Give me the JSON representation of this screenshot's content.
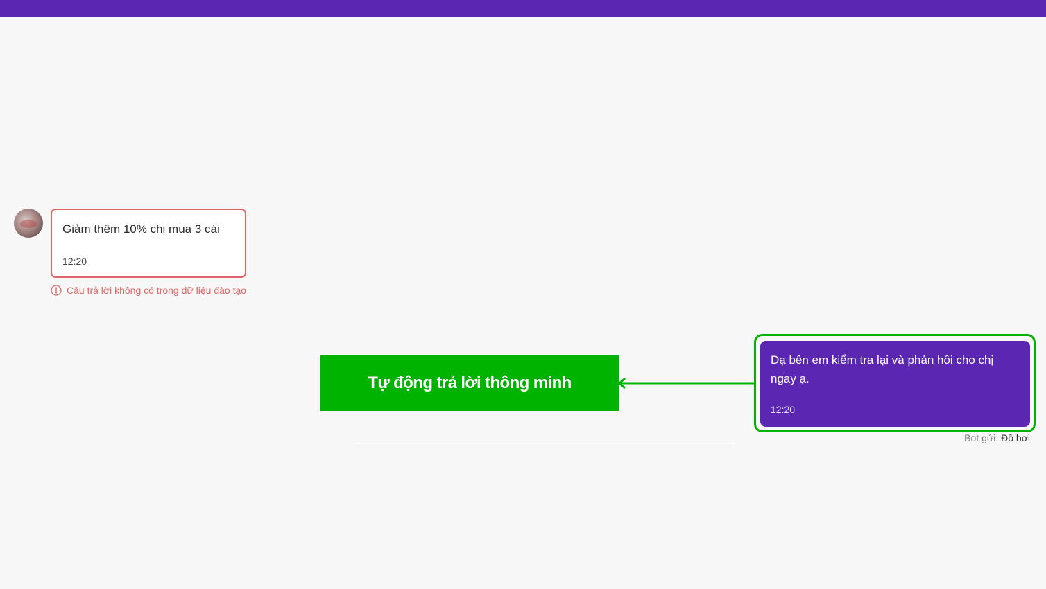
{
  "colors": {
    "top_bar": "#5b27b2",
    "incoming_border": "#e06666",
    "warning_text": "#e06666",
    "feature_label_bg": "#00b300",
    "highlight_frame": "#00b300",
    "outgoing_bubble_bg": "#5b27b2"
  },
  "incoming": {
    "message": "Giảm thêm 10% chị mua 3 cái",
    "time": "12:20",
    "warning_icon": "alert-circle-icon",
    "warning": "Câu trả lời không có trong dữ liệu đào tạo"
  },
  "feature_label": "Tự động trả lời thông minh",
  "outgoing": {
    "message": "Dạ bên em kiểm tra lại và phản hồi cho chị ngay ạ.",
    "time": "12:20",
    "sender_prefix": "Bot gửi:",
    "sender_name": "Đồ bơi"
  }
}
